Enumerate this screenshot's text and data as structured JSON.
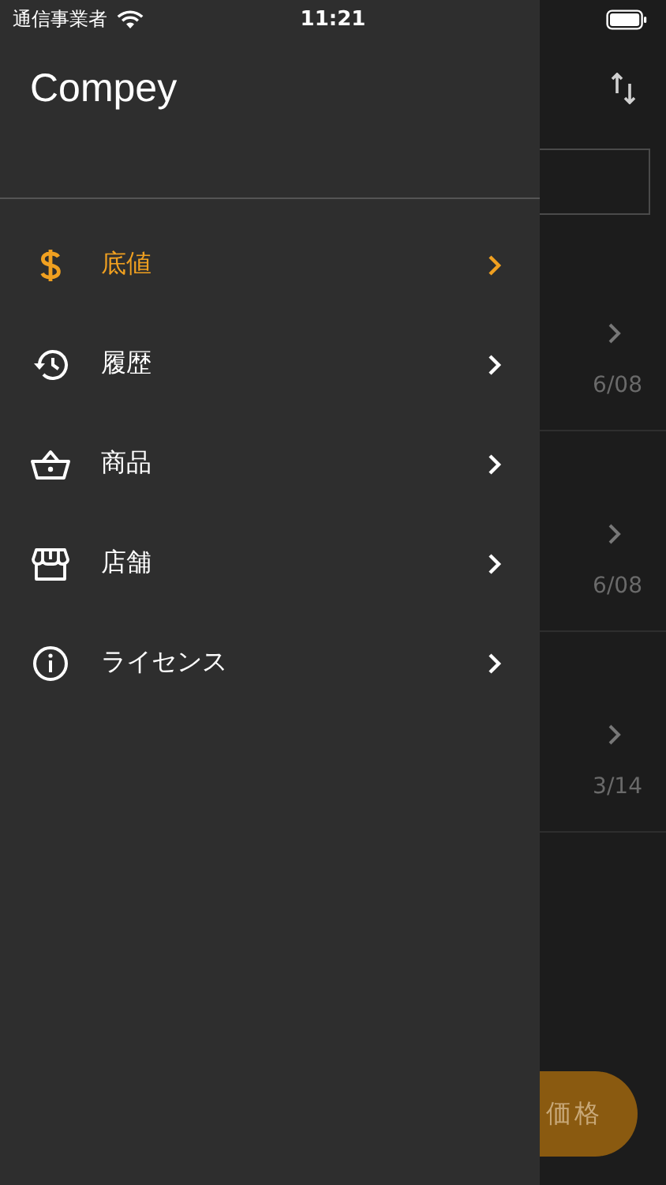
{
  "status_bar": {
    "carrier": "通信事業者",
    "time": "11:21"
  },
  "drawer": {
    "title": "Compey",
    "items": [
      {
        "label": "底値",
        "selected": true
      },
      {
        "label": "履歴",
        "selected": false
      },
      {
        "label": "商品",
        "selected": false
      },
      {
        "label": "店舗",
        "selected": false
      },
      {
        "label": "ライセンス",
        "selected": false
      }
    ]
  },
  "background": {
    "rows": [
      {
        "date": "6/08"
      },
      {
        "date": "6/08"
      },
      {
        "date": "3/14"
      }
    ],
    "fab": {
      "label": "価格"
    }
  }
}
